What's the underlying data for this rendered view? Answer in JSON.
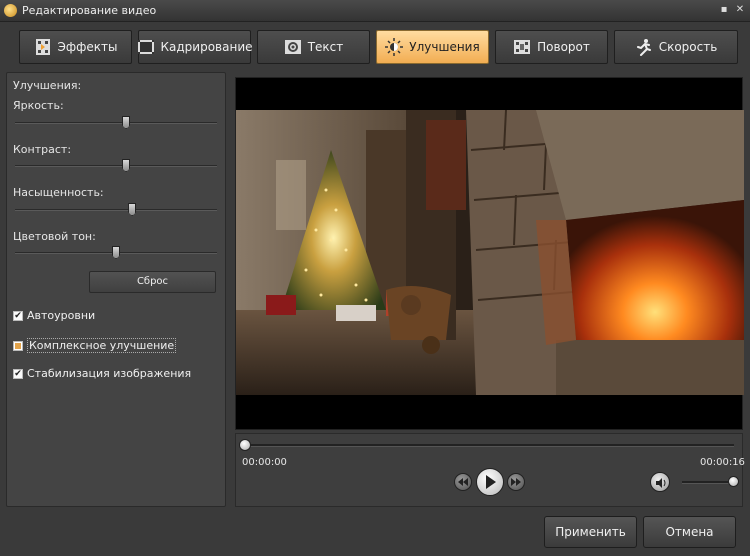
{
  "window": {
    "title": "Редактирование видео"
  },
  "tabs": [
    {
      "label": "Эффекты",
      "icon": "effects-icon",
      "active": false
    },
    {
      "label": "Кадрирование",
      "icon": "crop-icon",
      "active": false
    },
    {
      "label": "Текст",
      "icon": "text-icon",
      "active": false
    },
    {
      "label": "Улучшения",
      "icon": "enhance-icon",
      "active": true
    },
    {
      "label": "Поворот",
      "icon": "rotate-icon",
      "active": false
    },
    {
      "label": "Скорость",
      "icon": "runner-icon",
      "active": false
    }
  ],
  "panel": {
    "heading": "Улучшения:",
    "sliders": [
      {
        "label": "Яркость:",
        "value": 0.55
      },
      {
        "label": "Контраст:",
        "value": 0.55
      },
      {
        "label": "Насыщенность:",
        "value": 0.58
      },
      {
        "label": "Цветовой тон:",
        "value": 0.5
      }
    ],
    "reset_label": "Сброс",
    "checkboxes": [
      {
        "label": "Автоуровни",
        "state": "checked"
      },
      {
        "label": "Комплексное улучшение",
        "state": "partial"
      },
      {
        "label": "Стабилизация изображения",
        "state": "checked"
      }
    ]
  },
  "player": {
    "current_time": "00:00:00",
    "total_time": "00:00:16",
    "progress": 0.0,
    "volume": 0.95
  },
  "buttons": {
    "apply": "Применить",
    "cancel": "Отмена"
  },
  "colors": {
    "active_tab": "#f2ad52",
    "background": "#3a3a3a",
    "panel": "#444444"
  }
}
